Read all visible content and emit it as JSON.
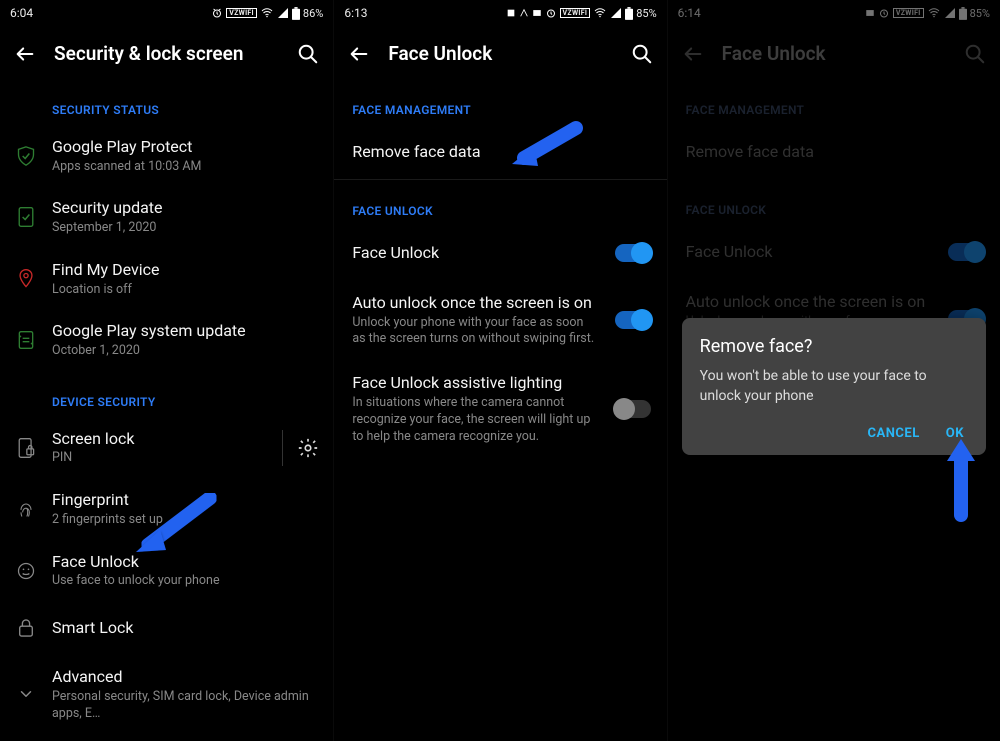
{
  "panel1": {
    "status": {
      "time": "6:04",
      "battery": "86%",
      "vwifi": "VZWIFI"
    },
    "title": "Security & lock screen",
    "sections": {
      "status_head": "SECURITY STATUS",
      "play_protect": {
        "title": "Google Play Protect",
        "sub": "Apps scanned at 10:03 AM"
      },
      "sec_update": {
        "title": "Security update",
        "sub": "September 1, 2020"
      },
      "find_device": {
        "title": "Find My Device",
        "sub": "Location is off"
      },
      "sys_update": {
        "title": "Google Play system update",
        "sub": "October 1, 2020"
      },
      "device_head": "DEVICE SECURITY",
      "screen_lock": {
        "title": "Screen lock",
        "sub": "PIN"
      },
      "fingerprint": {
        "title": "Fingerprint",
        "sub": "2 fingerprints set up"
      },
      "face_unlock": {
        "title": "Face Unlock",
        "sub": "Use face to unlock your phone"
      },
      "smart_lock": {
        "title": "Smart Lock"
      },
      "advanced": {
        "title": "Advanced",
        "sub": "Personal security, SIM card lock, Device admin apps, E…"
      }
    }
  },
  "panel2": {
    "status": {
      "time": "6:13",
      "battery": "85%",
      "vwifi": "VZWIFI"
    },
    "title": "Face Unlock",
    "mgmt_head": "FACE MANAGEMENT",
    "remove_face": "Remove face data",
    "unlock_head": "FACE UNLOCK",
    "face_unlock": {
      "title": "Face Unlock"
    },
    "auto_unlock": {
      "title": "Auto unlock once the screen is on",
      "sub": "Unlock your phone with your face as soon as the screen turns on without swiping first."
    },
    "assistive": {
      "title": "Face Unlock assistive lighting",
      "sub": "In situations where the camera cannot recognize your face, the screen will light up to help the camera recognize you."
    }
  },
  "panel3": {
    "status": {
      "time": "6:14",
      "battery": "85%",
      "vwifi": "VZWIFI"
    },
    "title": "Face Unlock",
    "mgmt_head": "FACE MANAGEMENT",
    "remove_face": "Remove face data",
    "unlock_head": "FACE UNLOCK",
    "face_unlock": {
      "title": "Face Unlock"
    },
    "auto_unlock": {
      "title": "Auto unlock once the screen is on",
      "sub": "Unlock your phone with your face as soon as the screen turns on without swiping first."
    },
    "dialog": {
      "title": "Remove face?",
      "message": "You won't be able to use your face to unlock your phone",
      "cancel": "CANCEL",
      "ok": "OK"
    }
  }
}
